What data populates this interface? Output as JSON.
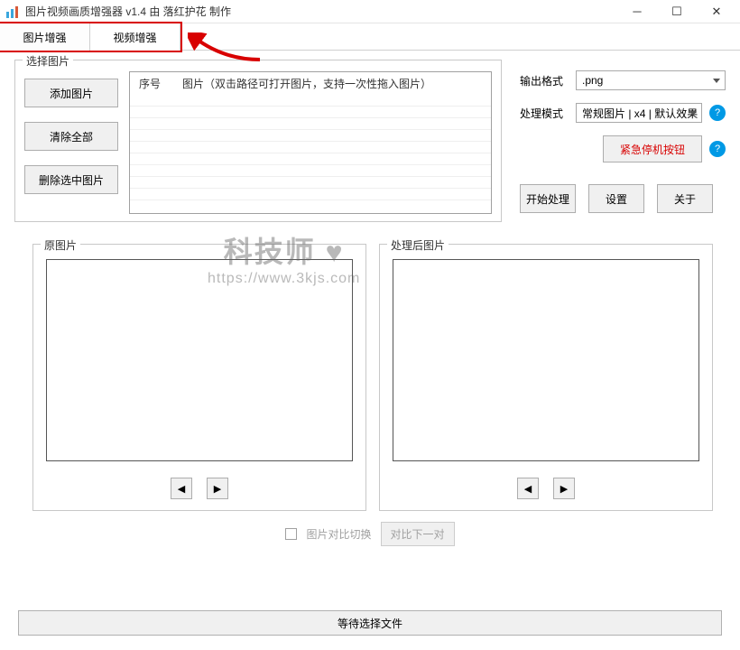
{
  "title": "图片视频画质增强器 v1.4     由 落红护花 制作",
  "tabs": {
    "image": "图片增强",
    "video": "视频增强"
  },
  "select_image_group": {
    "label": "选择图片",
    "add": "添加图片",
    "clear": "清除全部",
    "delete": "删除选中图片",
    "col_index": "序号",
    "col_path": "图片（双击路径可打开图片，支持一次性拖入图片）"
  },
  "right": {
    "format_label": "输出格式",
    "format_value": ".png",
    "mode_label": "处理模式",
    "mode_value": "常规图片 | x4 | 默认效果",
    "help": "?",
    "stop": "紧急停机按钮",
    "start": "开始处理",
    "settings": "设置",
    "about": "关于"
  },
  "preview": {
    "original": "原图片",
    "processed": "处理后图片"
  },
  "compare": {
    "toggle_label": "图片对比切换",
    "next": "对比下一对"
  },
  "status": "等待选择文件",
  "watermark": {
    "line1": "科技师",
    "line2": "https://www.3kjs.com"
  }
}
